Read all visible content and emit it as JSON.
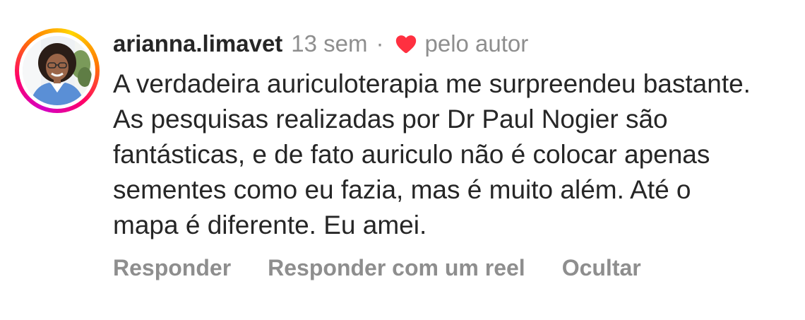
{
  "comment": {
    "username": "arianna.limavet",
    "time": "13 sem",
    "separator": "·",
    "liked_by_author_label": "pelo autor",
    "text": "A verdadeira auriculoterapia me surpreendeu bastante. As pesquisas realizadas por Dr Paul Nogier são fantásticas, e de fato auriculo não é colocar apenas sementes como eu fazia, mas é muito além. Até o mapa é diferente. Eu amei.",
    "avatar_icon": "profile-photo",
    "heart_icon": "heart-filled-icon",
    "heart_color": "#ff3040"
  },
  "actions": {
    "reply_label": "Responder",
    "reply_reel_label": "Responder com um reel",
    "hide_label": "Ocultar"
  },
  "colors": {
    "username": "#262626",
    "muted": "#8e8e8e",
    "story_ring": [
      "#d300c5",
      "#ff0069",
      "#ff7a00",
      "#ffd600"
    ]
  }
}
